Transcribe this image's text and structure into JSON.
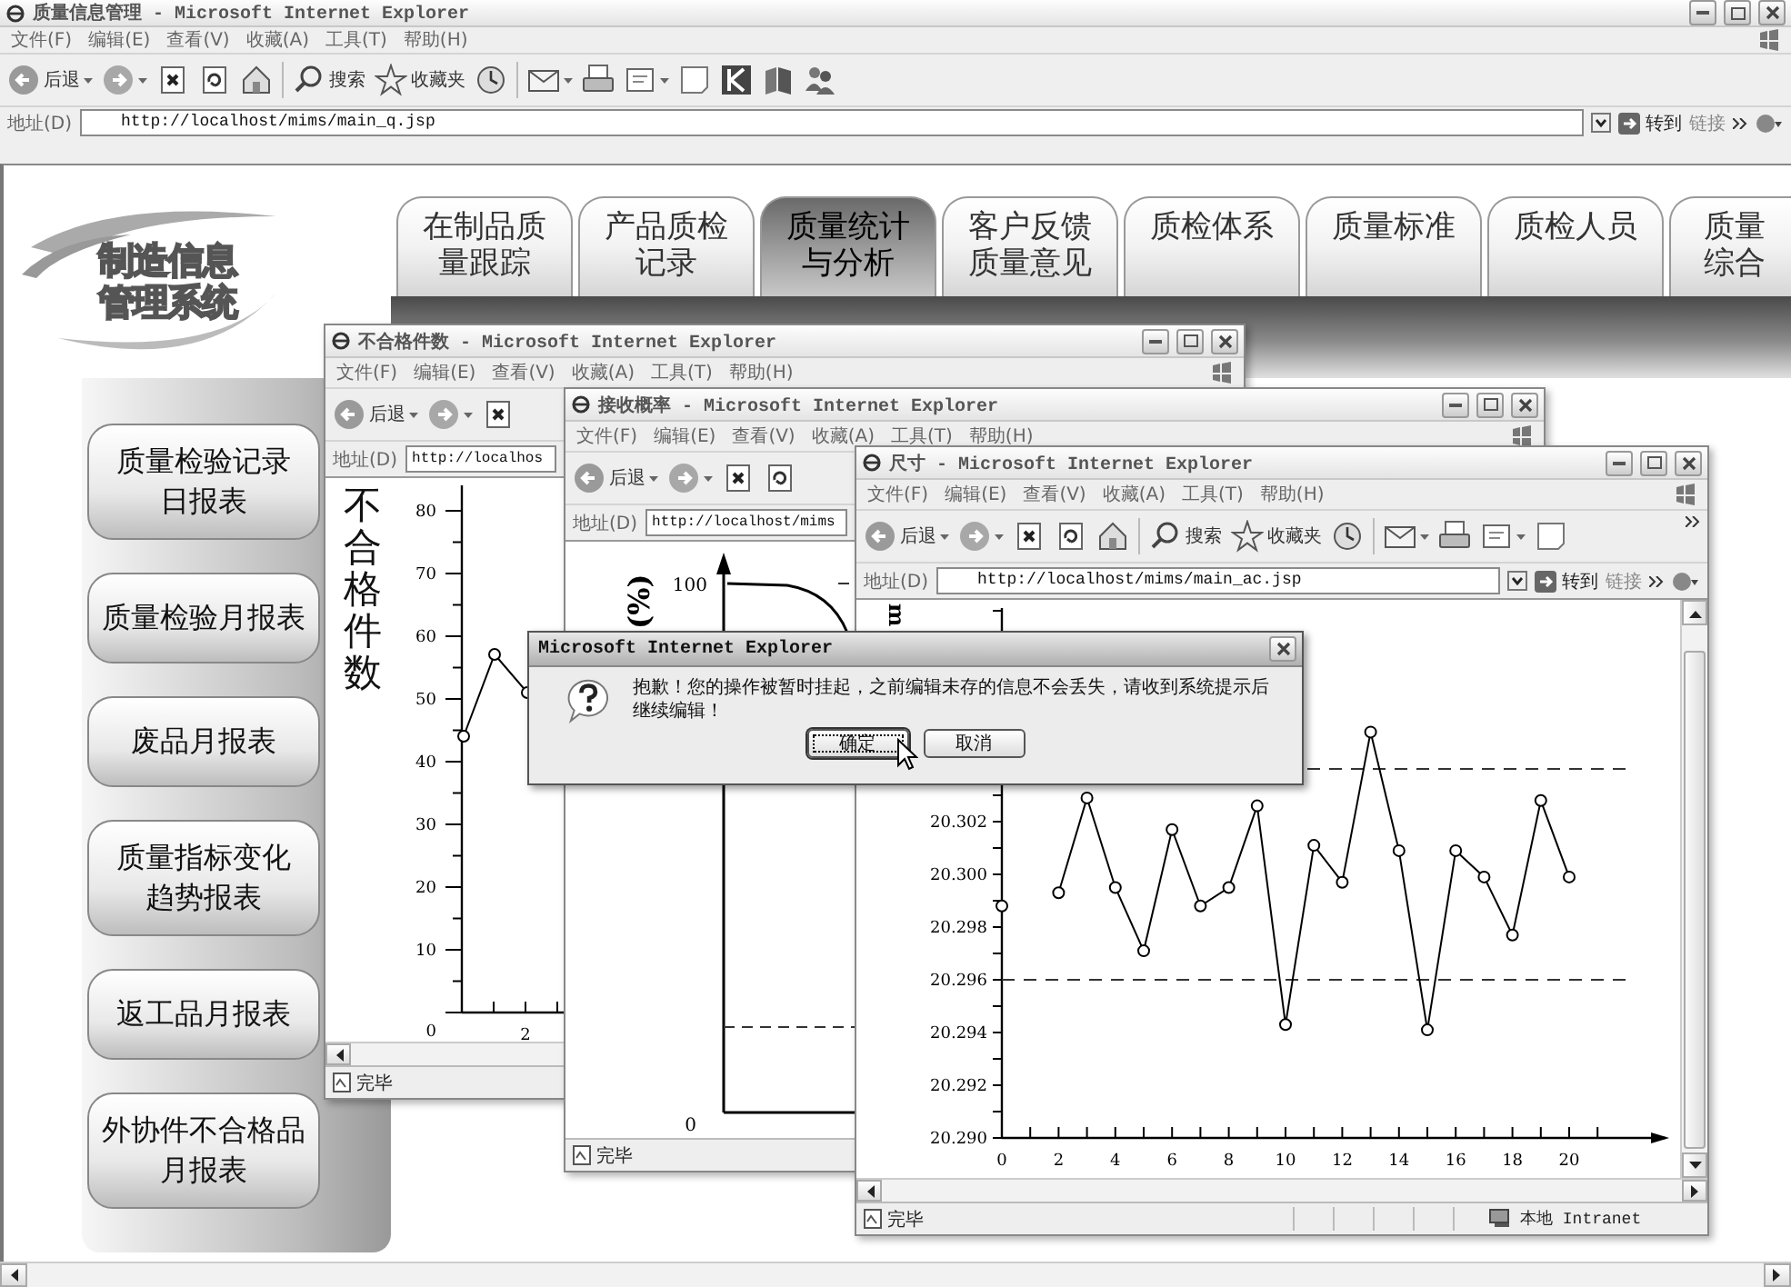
{
  "main_window": {
    "title": "质量信息管理 - Microsoft Internet Explorer",
    "menus": [
      "文件(F)",
      "编辑(E)",
      "查看(V)",
      "收藏(A)",
      "工具(T)",
      "帮助(H)"
    ],
    "toolbar": [
      {
        "kind": "back",
        "label": "后退"
      },
      {
        "kind": "forward"
      },
      {
        "kind": "stop"
      },
      {
        "kind": "refresh"
      },
      {
        "kind": "home"
      },
      {
        "kind": "search",
        "label": "搜索"
      },
      {
        "kind": "favorites",
        "label": "收藏夹"
      },
      {
        "kind": "history"
      },
      {
        "kind": "mail"
      },
      {
        "kind": "print"
      },
      {
        "kind": "edit"
      },
      {
        "kind": "note"
      },
      {
        "kind": "tile"
      },
      {
        "kind": "research"
      },
      {
        "kind": "users"
      }
    ],
    "address_label": "地址(D)",
    "address": "http://localhost/mims/main_q.jsp",
    "go_label": "转到",
    "links_label": "链接"
  },
  "logo": [
    "制造信息",
    "管理系统"
  ],
  "tabs": [
    {
      "lines": [
        "在制品质",
        "量跟踪"
      ],
      "selected": false
    },
    {
      "lines": [
        "产品质检",
        "记录"
      ],
      "selected": false
    },
    {
      "lines": [
        "质量统计",
        "与分析"
      ],
      "selected": true
    },
    {
      "lines": [
        "客户反馈",
        "质量意见"
      ],
      "selected": false
    },
    {
      "lines": [
        "质检体系"
      ],
      "selected": false
    },
    {
      "lines": [
        "质量标准"
      ],
      "selected": false
    },
    {
      "lines": [
        "质检人员"
      ],
      "selected": false
    },
    {
      "lines": [
        "质量",
        "综合"
      ],
      "selected": false
    }
  ],
  "reports": [
    {
      "lines": [
        "质量检验记录",
        "日报表"
      ]
    },
    {
      "lines": [
        "质量检验月报表"
      ]
    },
    {
      "lines": [
        "废品月报表"
      ]
    },
    {
      "lines": [
        "质量指标变化",
        "趋势报表"
      ]
    },
    {
      "lines": [
        "返工品月报表"
      ]
    },
    {
      "lines": [
        "外协件不合格品",
        "月报表"
      ]
    }
  ],
  "windows": [
    {
      "title": "不合格件数 - Microsoft Internet Explorer",
      "menus": [
        "文件(F)",
        "编辑(E)",
        "查看(V)",
        "收藏(A)",
        "工具(T)",
        "帮助(H)"
      ],
      "toolbar": [
        {
          "kind": "back",
          "label": "后退"
        },
        {
          "kind": "forward"
        },
        {
          "kind": "stop"
        }
      ],
      "address_label": "地址(D)",
      "address": "http://localhos",
      "status": "完毕",
      "axis": {
        "ylabel": "不合格件数",
        "y_labels": [
          "80",
          "70",
          "60",
          "50",
          "40",
          "30",
          "20",
          "10",
          "0"
        ],
        "x_labels": [
          "2"
        ]
      }
    },
    {
      "title": "接收概率 - Microsoft Internet Explorer",
      "menus": [
        "文件(F)",
        "编辑(E)",
        "查看(V)",
        "收藏(A)",
        "工具(T)",
        "帮助(H)"
      ],
      "toolbar": [
        {
          "kind": "back",
          "label": "后退"
        },
        {
          "kind": "forward"
        },
        {
          "kind": "stop"
        },
        {
          "kind": "refresh"
        }
      ],
      "address_label": "地址(D)",
      "address": "http://localhost/mims",
      "status": "完毕",
      "curve": {
        "ylabel": "(%)",
        "top_label": "100",
        "bottom_label": "0"
      }
    },
    {
      "title": "尺寸 - Microsoft Internet Explorer",
      "menus": [
        "文件(F)",
        "编辑(E)",
        "查看(V)",
        "收藏(A)",
        "工具(T)",
        "帮助(H)"
      ],
      "toolbar": [
        {
          "kind": "back",
          "label": "后退"
        },
        {
          "kind": "forward"
        },
        {
          "kind": "stop"
        },
        {
          "kind": "refresh"
        },
        {
          "kind": "home"
        },
        {
          "kind": "search",
          "label": "搜索"
        },
        {
          "kind": "favorites",
          "label": "收藏夹"
        },
        {
          "kind": "history"
        },
        {
          "kind": "mail"
        },
        {
          "kind": "print"
        },
        {
          "kind": "edit"
        },
        {
          "kind": "note"
        }
      ],
      "address_label": "地址(D)",
      "address": "http://localhost/mims/main_ac.jsp",
      "go_label": "转到",
      "links_label": "链接",
      "status": "完毕",
      "zone": "本地 Intranet",
      "chart_data": {
        "type": "line",
        "ylabel": "m",
        "x": [
          0,
          1,
          2,
          3,
          4,
          5,
          6,
          7,
          8,
          9,
          10,
          11,
          12,
          13,
          14,
          15,
          16,
          17,
          18,
          19,
          20
        ],
        "series": [
          {
            "color": "#000000",
            "marker": "circle",
            "values": [
              20.2988,
              null,
              20.2993,
              20.3029,
              20.2995,
              20.2971,
              20.3017,
              20.2988,
              20.2995,
              20.3026,
              20.2943,
              20.3011,
              20.2997,
              20.3054,
              20.3009,
              20.2941,
              20.3009,
              20.2999,
              20.2977,
              20.3028,
              20.2999
            ]
          }
        ],
        "xticks": [
          0,
          2,
          4,
          6,
          8,
          10,
          12,
          14,
          16,
          18,
          20
        ],
        "yticks": [
          {
            "value": 20.29,
            "label": "20.290"
          },
          {
            "value": 20.292,
            "label": "20.292"
          },
          {
            "value": 20.294,
            "label": "20.294"
          },
          {
            "value": 20.296,
            "label": "20.296"
          },
          {
            "value": 20.298,
            "label": "20.298"
          },
          {
            "value": 20.3,
            "label": "20.300"
          },
          {
            "value": 20.302,
            "label": "20.302"
          }
        ],
        "xlim": [
          0,
          23.4
        ],
        "ylim": [
          20.29,
          20.3101
        ],
        "ref_lines": [
          {
            "axis": "y",
            "value": 20.304
          },
          {
            "axis": "y",
            "value": 20.296
          }
        ]
      }
    }
  ],
  "dialog": {
    "title": "Microsoft Internet Explorer",
    "message": "抱歉！您的操作被暂时挂起，之前编辑未存的信息不会丢失，请收到系统提示后继续编辑！",
    "buttons": [
      {
        "label": "确定",
        "selected": true
      },
      {
        "label": "取消",
        "selected": false
      }
    ]
  }
}
